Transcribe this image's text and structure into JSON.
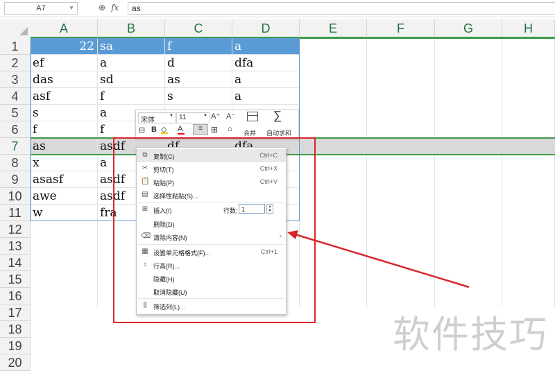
{
  "formula_bar": {
    "name_box": "A7",
    "fx_label": "fx",
    "formula_value": "as"
  },
  "columns": [
    "A",
    "B",
    "C",
    "D",
    "E",
    "F",
    "G",
    "H"
  ],
  "rows": [
    "1",
    "2",
    "3",
    "4",
    "5",
    "6",
    "7",
    "8",
    "9",
    "10",
    "11",
    "12",
    "13",
    "14",
    "15",
    "16",
    "17",
    "18",
    "19",
    "20"
  ],
  "cells": [
    [
      "22",
      "sa",
      "f",
      "a"
    ],
    [
      "ef",
      "a",
      "d",
      "dfa"
    ],
    [
      "das",
      "sd",
      "as",
      "a"
    ],
    [
      "asf",
      "f",
      "s",
      "a"
    ],
    [
      "s",
      "a",
      "",
      ""
    ],
    [
      "f",
      "f",
      "",
      ""
    ],
    [
      "as",
      "asdf",
      "df",
      "dfa"
    ],
    [
      "x",
      "a",
      "",
      ""
    ],
    [
      "asasf",
      "asdf",
      "",
      ""
    ],
    [
      "awe",
      "asdf",
      "",
      ""
    ],
    [
      "w",
      "fra",
      "",
      ""
    ]
  ],
  "mini_toolbar": {
    "font_name": "宋体",
    "font_size": "11",
    "grow_font": "A⁺",
    "shrink_font": "A⁻",
    "bold": "B",
    "font_color_glyph": "A",
    "merge_label": "合并",
    "autosum_label": "自动求和"
  },
  "context_menu": {
    "items": [
      {
        "label": "复制(C)",
        "shortcut": "Ctrl+C",
        "icon": "copy-icon"
      },
      {
        "label": "剪切(T)",
        "shortcut": "Ctrl+X",
        "icon": "scissors-icon"
      },
      {
        "label": "粘贴(P)",
        "shortcut": "Ctrl+V",
        "icon": "paste-icon"
      },
      {
        "label": "选择性粘贴(S)...",
        "shortcut": "",
        "icon": "paste-special-icon"
      },
      {
        "label": "插入(I)",
        "shortcut": "",
        "icon": "insert-icon"
      },
      {
        "label": "删除(D)",
        "shortcut": "",
        "icon": ""
      },
      {
        "label": "清除内容(N)",
        "shortcut": "",
        "icon": "eraser-icon"
      },
      {
        "label": "设置单元格格式(F)...",
        "shortcut": "Ctrl+1",
        "icon": "format-cells-icon"
      },
      {
        "label": "行高(R)...",
        "shortcut": "",
        "icon": "row-height-icon"
      },
      {
        "label": "隐藏(H)",
        "shortcut": "",
        "icon": ""
      },
      {
        "label": "取消隐藏(U)",
        "shortcut": "",
        "icon": ""
      },
      {
        "label": "筛选列(L)...",
        "shortcut": "",
        "icon": "filter-column-icon"
      }
    ],
    "row_count_label": "行数:",
    "row_count_value": "1",
    "submenu_arrow": "›"
  },
  "watermark": "软件技巧",
  "colors": {
    "header_row": "#5b9bd5",
    "selection_green": "#3c9a4a",
    "annotation_red": "#d9262c"
  }
}
